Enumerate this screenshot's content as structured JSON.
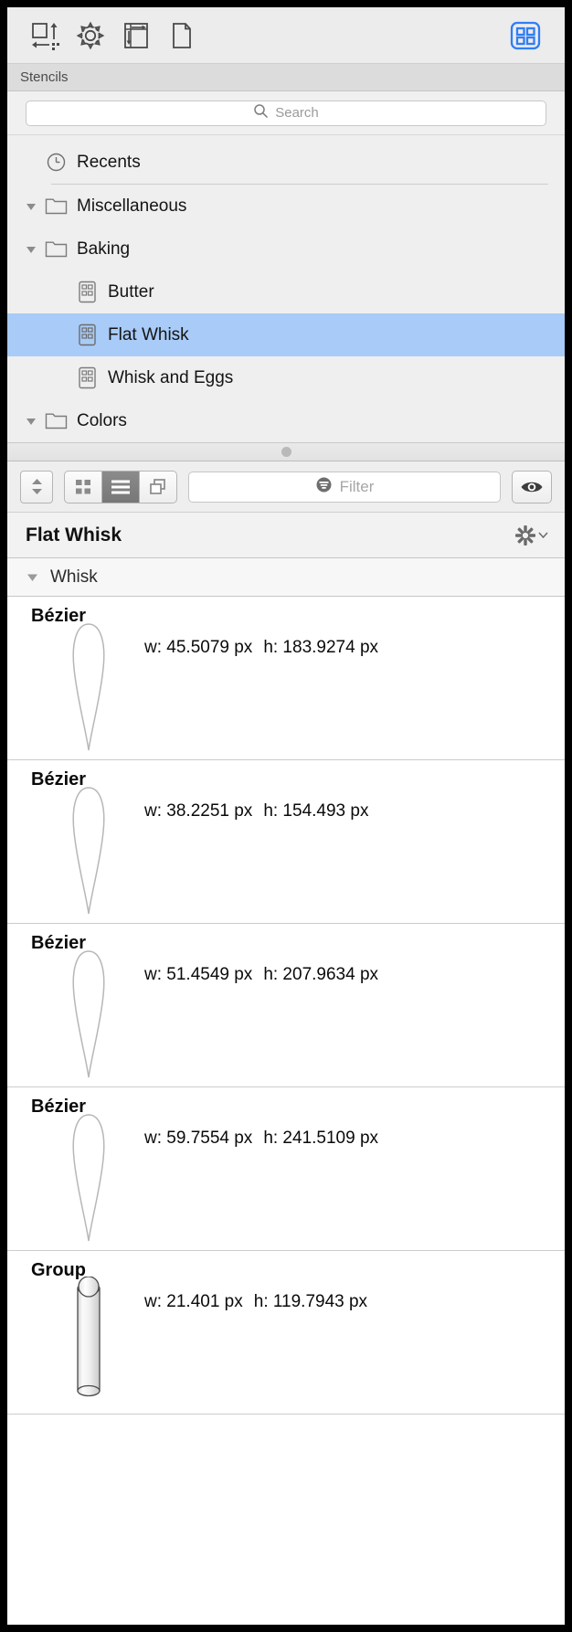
{
  "toolbar": {
    "buttons": [
      {
        "name": "resize-canvas-icon",
        "label": "Canvas Size"
      },
      {
        "name": "gear-settings-icon",
        "label": "Settings"
      },
      {
        "name": "grid-guides-icon",
        "label": "Grid and Guides"
      },
      {
        "name": "document-page-icon",
        "label": "Document"
      }
    ],
    "right_button": {
      "name": "stencils-grid-icon",
      "label": "Stencils",
      "active": true,
      "color": "#2f7ef5"
    }
  },
  "stencils_bar": {
    "title": "Stencils"
  },
  "search": {
    "placeholder": "Search",
    "value": "",
    "icon": "search-icon"
  },
  "tree": {
    "items": [
      {
        "label": "Recents",
        "icon": "clock-icon",
        "level": 0,
        "disclosure": "none",
        "selected": false,
        "separator_below": true
      },
      {
        "label": "Miscellaneous",
        "icon": "folder-icon",
        "level": 0,
        "disclosure": "open",
        "selected": false,
        "separator_below": false
      },
      {
        "label": "Baking",
        "icon": "folder-icon",
        "level": 0,
        "disclosure": "open",
        "selected": false,
        "separator_below": false
      },
      {
        "label": "Butter",
        "icon": "stencil-icon",
        "level": 1,
        "disclosure": "none",
        "selected": false,
        "separator_below": false
      },
      {
        "label": "Flat Whisk",
        "icon": "stencil-icon",
        "level": 1,
        "disclosure": "none",
        "selected": true,
        "separator_below": false
      },
      {
        "label": "Whisk and Eggs",
        "icon": "stencil-icon",
        "level": 1,
        "disclosure": "none",
        "selected": false,
        "separator_below": false
      },
      {
        "label": "Colors",
        "icon": "folder-icon",
        "level": 0,
        "disclosure": "open",
        "selected": false,
        "separator_below": false
      }
    ],
    "selection_color": "#a8cbf7"
  },
  "midbar": {
    "stepper": {
      "name": "sort-stepper",
      "up": "▲",
      "down": "▼"
    },
    "view_modes": [
      {
        "name": "grid-view-icon",
        "active": false
      },
      {
        "name": "list-view-icon",
        "active": true
      },
      {
        "name": "layers-view-icon",
        "active": false
      }
    ],
    "filter": {
      "placeholder": "Filter",
      "value": "",
      "icon": "filter-icon"
    },
    "visibility": {
      "name": "eye-icon",
      "label": "Show/Hide"
    }
  },
  "inspector": {
    "title": "Flat Whisk",
    "action_menu": {
      "name": "gear-menu",
      "icon": "gear-icon",
      "chevron": "⌄"
    }
  },
  "group": {
    "label": "Whisk",
    "disclosure": "open"
  },
  "objects": [
    {
      "kind": "Bézier",
      "width": "w: 45.5079 px",
      "height": "h: 183.9274 px",
      "shape": "teardrop"
    },
    {
      "kind": "Bézier",
      "width": "w: 38.2251 px",
      "height": "h: 154.493 px",
      "shape": "teardrop"
    },
    {
      "kind": "Bézier",
      "width": "w: 51.4549 px",
      "height": "h: 207.9634 px",
      "shape": "teardrop"
    },
    {
      "kind": "Bézier",
      "width": "w: 59.7554 px",
      "height": "h: 241.5109 px",
      "shape": "teardrop"
    },
    {
      "kind": "Group",
      "width": "w: 21.401 px",
      "height": "h: 119.7943 px",
      "shape": "cylinder"
    }
  ]
}
